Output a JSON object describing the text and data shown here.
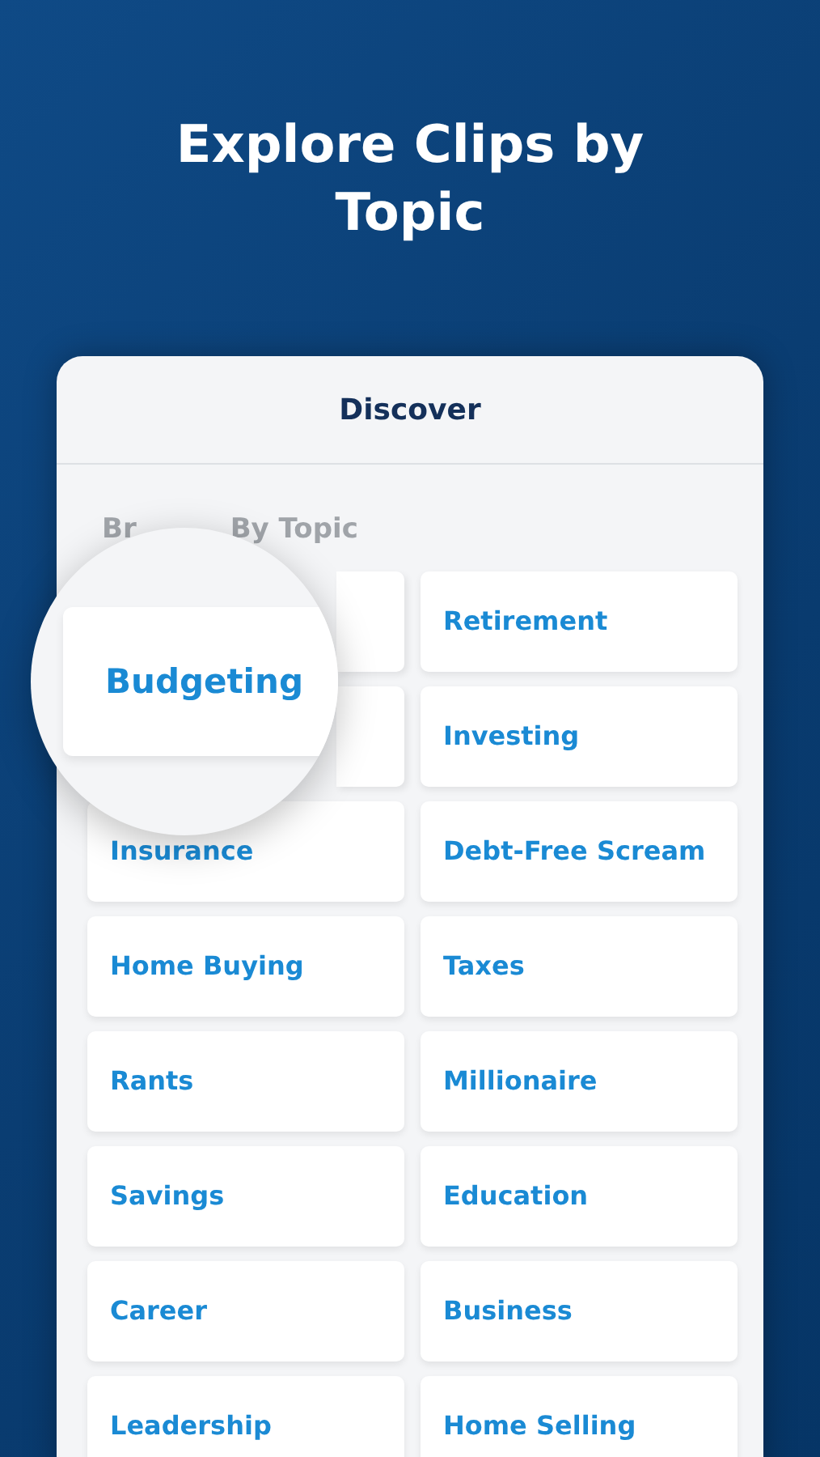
{
  "title": "Explore Clips by Topic",
  "screen": {
    "header": "Discover",
    "section_heading": {
      "visible_start": "Br",
      "visible_end": "By Topic"
    },
    "magnifier": {
      "label": "Budgeting"
    },
    "left_column": [
      {
        "label": "Insurance"
      },
      {
        "label": "Home Buying"
      },
      {
        "label": "Rants"
      },
      {
        "label": "Savings"
      },
      {
        "label": "Career"
      },
      {
        "label": "Leadership"
      }
    ],
    "right_column": [
      {
        "label": "Retirement"
      },
      {
        "label": "Investing"
      },
      {
        "label": "Debt-Free Scream"
      },
      {
        "label": "Taxes"
      },
      {
        "label": "Millionaire"
      },
      {
        "label": "Education"
      },
      {
        "label": "Business"
      },
      {
        "label": "Home Selling"
      }
    ]
  }
}
